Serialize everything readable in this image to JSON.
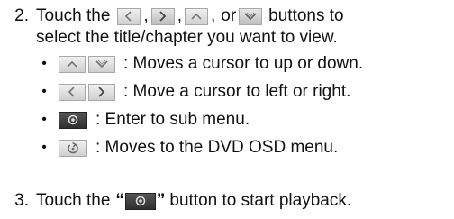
{
  "step2": {
    "number": "2.",
    "line1_prefix": "Touch the",
    "comma": ",",
    "or": "or",
    "line1_suffix": "buttons to",
    "line2": "select the title/chapter you want to view.",
    "icons": [
      "left-arrow-icon",
      "right-arrow-icon",
      "up-arrow-icon",
      "down-arrow-icon"
    ]
  },
  "bullets": [
    {
      "marker": "•",
      "text": ": Moves a cursor to up or down.",
      "icons": [
        "up-arrow-icon",
        "down-arrow-icon"
      ]
    },
    {
      "marker": "•",
      "text": ": Move a cursor  to left or right.",
      "icons": [
        "left-arrow-icon",
        "right-arrow-icon"
      ]
    },
    {
      "marker": "•",
      "text": ": Enter to sub menu.",
      "icons": [
        "enter-icon"
      ]
    },
    {
      "marker": "•",
      "text": ": Moves to the DVD OSD menu.",
      "icons": [
        "return-icon"
      ]
    }
  ],
  "step3": {
    "number": "3.",
    "prefix": "Touch the",
    "open_quote": "“",
    "close_quote": "”",
    "suffix": "button to start playback.",
    "icons": [
      "enter-icon"
    ]
  }
}
